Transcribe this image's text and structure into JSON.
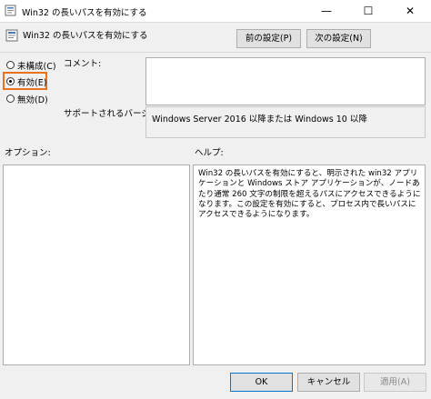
{
  "window": {
    "title": "Win32 の長いパスを有効にする",
    "controls": {
      "minimize": "—",
      "maximize": "☐",
      "close": "✕"
    }
  },
  "header": {
    "title": "Win32 の長いパスを有効にする",
    "prev_label": "前の設定(P)",
    "next_label": "次の設定(N)"
  },
  "state": {
    "options": [
      {
        "label": "未構成(C)",
        "checked": false
      },
      {
        "label": "有効(E)",
        "checked": true
      },
      {
        "label": "無効(D)",
        "checked": false
      }
    ]
  },
  "labels": {
    "comment": "コメント:",
    "supported_on": "サポートされるバージョン:",
    "options": "オプション:",
    "help": "ヘルプ:"
  },
  "fields": {
    "comment_value": "",
    "supported_value": "Windows Server 2016 以降または Windows 10 以降"
  },
  "help_text": "Win32 の長いパスを有効にすると、明示された win32 アプリケーションと Windows ストア アプリケーションが、ノードあたり通常 260 文字の制限を超えるパスにアクセスできるようになります。この設定を有効にすると、プロセス内で長いパスにアクセスできるようになります。",
  "footer": {
    "ok_label": "OK",
    "cancel_label": "キャンセル",
    "apply_label": "適用(A)"
  },
  "colors": {
    "focus_highlight": "#e8731e",
    "window_bg": "#f0f0f0",
    "button_bg": "#e1e1e1"
  }
}
